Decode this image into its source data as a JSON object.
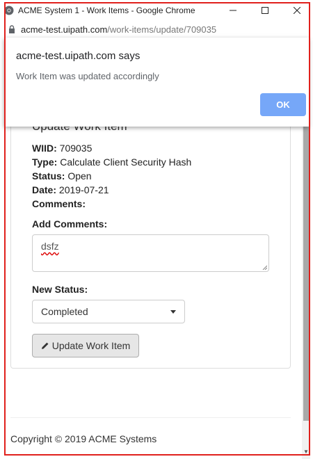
{
  "window": {
    "title": "ACME System 1 - Work Items - Google Chrome",
    "minimize_icon": "minimize-icon",
    "maximize_icon": "maximize-icon",
    "close_icon": "close-icon"
  },
  "address_bar": {
    "host": "acme-test.uipath.com",
    "path": "/work-items/update/709035"
  },
  "dialog": {
    "title": "acme-test.uipath.com says",
    "message": "Work Item was updated accordingly",
    "ok_label": "OK"
  },
  "work_item": {
    "heading": "Update Work Item",
    "fields": [
      {
        "label": "WIID:",
        "value": "709035"
      },
      {
        "label": "Type:",
        "value": "Calculate Client Security Hash"
      },
      {
        "label": "Status:",
        "value": "Open"
      },
      {
        "label": "Date:",
        "value": "2019-07-21"
      },
      {
        "label": "Comments:",
        "value": ""
      }
    ],
    "add_comments_label": "Add Comments:",
    "comments_value": "dsfz",
    "new_status_label": "New Status:",
    "new_status_value": "Completed",
    "update_button_label": "Update Work Item"
  },
  "footer": {
    "text": "Copyright © 2019 ACME Systems"
  },
  "colors": {
    "frame_highlight": "#e0201c",
    "ok_button": "#76a7f8"
  }
}
